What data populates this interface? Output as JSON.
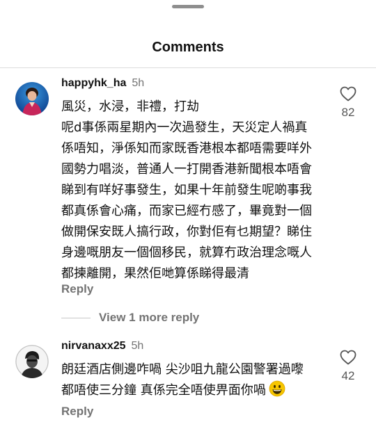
{
  "header": {
    "title": "Comments"
  },
  "comments": [
    {
      "username": "happyhk_ha",
      "time": "5h",
      "lines": [
        "風災，水浸，非禮，打劫",
        "呢d事係兩星期內一次過發生，天災定人禍真",
        "係唔知，淨係知而家既香港根本都唔需要咩外",
        "國勢力唱淡，普通人一打開香港新聞根本唔會",
        "睇到有咩好事發生，如果十年前發生呢啲事我",
        "都真係會心痛，而家已經冇感了，畢竟對一個",
        "做開保安既人搞行政，你對佢有乜期望？睇住",
        "身邊嘅朋友一個個移民，就算冇政治理念嘅人",
        "都揀離開，果然佢哋算係睇得最清"
      ],
      "reply_label": "Reply",
      "like_count": "82",
      "view_more": "View 1 more reply"
    },
    {
      "username": "nirvanaxx25",
      "time": "5h",
      "lines": [
        "朗廷酒店側邊咋喎  尖沙咀九龍公園警署過嚟",
        "都唔使三分鐘  真係完全唔使畀面你喎"
      ],
      "emoji_icon": "grinning-face-emoji",
      "reply_label": "Reply",
      "like_count": "42"
    }
  ],
  "colors": {
    "secondary_text": "#737373",
    "divider": "#dbdbdb"
  }
}
